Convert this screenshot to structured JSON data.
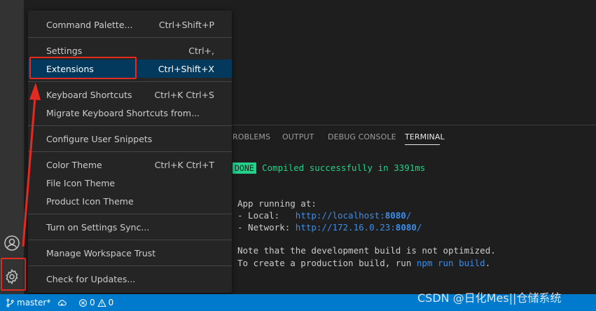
{
  "menu": {
    "items": [
      {
        "label": "Command Palette...",
        "shortcut": "Ctrl+Shift+P"
      },
      {
        "label": "Settings",
        "shortcut": "Ctrl+,"
      },
      {
        "label": "Extensions",
        "shortcut": "Ctrl+Shift+X"
      },
      {
        "label": "Keyboard Shortcuts",
        "shortcut": "Ctrl+K Ctrl+S"
      },
      {
        "label": "Migrate Keyboard Shortcuts from...",
        "shortcut": ""
      },
      {
        "label": "Configure User Snippets",
        "shortcut": ""
      },
      {
        "label": "Color Theme",
        "shortcut": "Ctrl+K Ctrl+T"
      },
      {
        "label": "File Icon Theme",
        "shortcut": ""
      },
      {
        "label": "Product Icon Theme",
        "shortcut": ""
      },
      {
        "label": "Turn on Settings Sync...",
        "shortcut": ""
      },
      {
        "label": "Manage Workspace Trust",
        "shortcut": ""
      },
      {
        "label": "Check for Updates...",
        "shortcut": ""
      }
    ]
  },
  "panel": {
    "tabs": [
      "ROBLEMS",
      "OUTPUT",
      "DEBUG CONSOLE",
      "TERMINAL"
    ]
  },
  "terminal": {
    "done_badge": "DONE",
    "compiled": "Compiled successfully in 3391ms",
    "app_running": "App running at:",
    "local_label": "- Local:   ",
    "local_url_prefix": "http://localhost:",
    "local_port": "8080",
    "local_slash": "/",
    "network_label": "- Network: ",
    "network_url_prefix": "http://172.16.0.23:",
    "network_port": "8080",
    "network_slash": "/",
    "note_line": "Note that the development build is not optimized.",
    "prod_prefix": "To create a production build, run ",
    "prod_cmd": "npm run build",
    "prod_suffix": "."
  },
  "status": {
    "branch": "master*",
    "errors": "0",
    "warnings": "0"
  },
  "watermark": "CSDN @日化Mes||仓储系统",
  "colors": {
    "accent": "#007acc",
    "highlight_box": "#e32b22",
    "menu_active": "#04395e",
    "terminal_green": "#23d18b",
    "terminal_link": "#3b8eea"
  }
}
